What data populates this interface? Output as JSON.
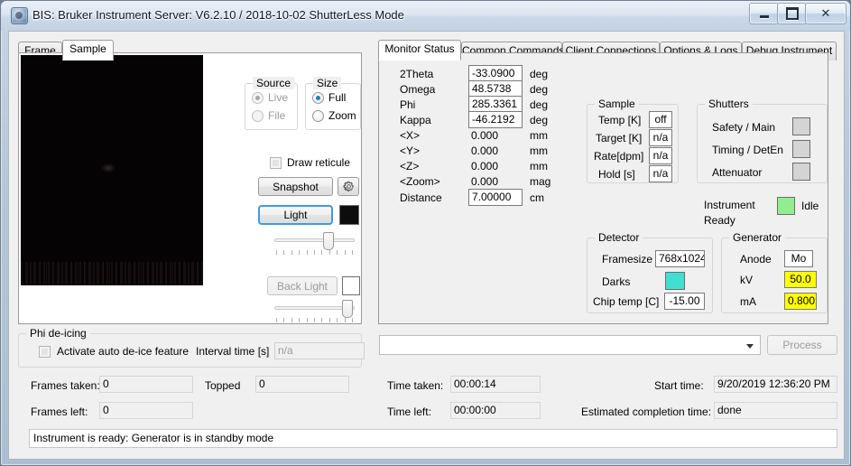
{
  "window": {
    "title": "BIS: Bruker Instrument Server: V6.2.10 / 2018-10-02    ShutterLess Mode",
    "minimize_label": "Minimize",
    "maximize_label": "Maximize",
    "close_label": "✕"
  },
  "left_panel": {
    "tabs": [
      {
        "label": "Frame",
        "active": false
      },
      {
        "label": "Sample",
        "active": true
      }
    ],
    "source_group": {
      "caption": "Source",
      "options": [
        {
          "label": "Live",
          "selected": true,
          "disabled": true
        },
        {
          "label": "File",
          "selected": false,
          "disabled": true
        }
      ]
    },
    "size_group": {
      "caption": "Size",
      "options": [
        {
          "label": "Full",
          "selected": true,
          "disabled": false
        },
        {
          "label": "Zoom",
          "selected": false,
          "disabled": false
        }
      ]
    },
    "draw_reticule": {
      "label": "Draw reticule",
      "checked": false
    },
    "snapshot_button": "Snapshot",
    "settings_icon": "gear-icon",
    "light_button": "Light",
    "light_color": "#0d0d0d",
    "back_light_button": "Back Light",
    "back_light_color": "#ffffff",
    "light_slider_value": 62,
    "back_light_slider_value": 86
  },
  "phi_deicing": {
    "caption": "Phi de-icing",
    "activate_label": "Activate auto de-ice feature",
    "activate_checked": false,
    "interval_label": "Interval time [s]",
    "interval_value": "n/a"
  },
  "frames": {
    "taken_label": "Frames taken:",
    "taken_value": "0",
    "left_label": "Frames left:",
    "left_value": "0",
    "topped_label": "Topped",
    "topped_value": "0"
  },
  "right_panel": {
    "tabs": [
      {
        "label": "Monitor Status",
        "active": true
      },
      {
        "label": "Common Commands",
        "active": false
      },
      {
        "label": "Client Connections",
        "active": false
      },
      {
        "label": "Options & Logs",
        "active": false
      },
      {
        "label": "Debug Instrument",
        "active": false
      }
    ],
    "axes": [
      {
        "name": "2Theta",
        "value": "-33.0900",
        "unit": "deg",
        "editable": true
      },
      {
        "name": "Omega",
        "value": "48.5738",
        "unit": "deg",
        "editable": true
      },
      {
        "name": "Phi",
        "value": "285.3361",
        "unit": "deg",
        "editable": true
      },
      {
        "name": "Kappa",
        "value": "-46.2192",
        "unit": "deg",
        "editable": true
      },
      {
        "name": "<X>",
        "value": "0.000",
        "unit": "mm",
        "editable": false
      },
      {
        "name": "<Y>",
        "value": "0.000",
        "unit": "mm",
        "editable": false
      },
      {
        "name": "<Z>",
        "value": "0.000",
        "unit": "mm",
        "editable": false
      },
      {
        "name": "<Zoom>",
        "value": "0.000",
        "unit": "mag",
        "editable": false
      },
      {
        "name": "Distance",
        "value": "7.00000",
        "unit": "cm",
        "editable": true
      }
    ],
    "sample_group": {
      "caption": "Sample",
      "rows": [
        {
          "label": "Temp [K]",
          "value": "off"
        },
        {
          "label": "Target [K]",
          "value": "n/a"
        },
        {
          "label": "Rate[dpm]",
          "value": "n/a"
        },
        {
          "label": "Hold [s]",
          "value": "n/a"
        }
      ]
    },
    "shutters_group": {
      "caption": "Shutters",
      "rows": [
        {
          "label": "Safety / Main",
          "color": "#d4d4d4"
        },
        {
          "label": "Timing / DetEn",
          "color": "#d4d4d4"
        },
        {
          "label": "Attenuator",
          "color": "#d4d4d4"
        }
      ]
    },
    "instrument_status": {
      "label_line1": "Instrument",
      "label_line2": "Ready",
      "state": "Idle",
      "color": "#90ee90"
    },
    "detector_group": {
      "caption": "Detector",
      "framesize_label": "Framesize",
      "framesize_value": "768x1024",
      "darks_label": "Darks",
      "darks_color": "#40e0d0",
      "chiptemp_label": "Chip temp [C]",
      "chiptemp_value": "-15.00"
    },
    "generator_group": {
      "caption": "Generator",
      "anode_label": "Anode",
      "anode_value": "Mo",
      "kv_label": "kV",
      "kv_value": "50.0",
      "ma_label": "mA",
      "ma_value": "0.800",
      "highlight_color": "#ffff00"
    }
  },
  "process_row": {
    "combo_value": "",
    "process_button": "Process"
  },
  "timing": {
    "time_taken_label": "Time taken:",
    "time_taken_value": "00:00:14",
    "time_left_label": "Time left:",
    "time_left_value": "00:00:00",
    "start_time_label": "Start time:",
    "start_time_value": "9/20/2019 12:36:20 PM",
    "eta_label": "Estimated completion time:",
    "eta_value": "done"
  },
  "statusbar": {
    "message": "Instrument is ready: Generator is in standby mode"
  }
}
